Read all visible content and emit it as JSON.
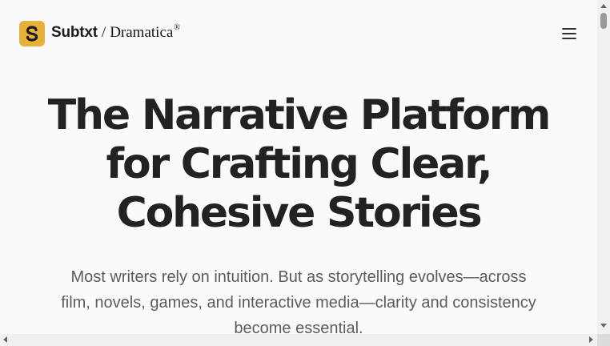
{
  "header": {
    "brand_name": "Subtxt",
    "brand_separator": "/",
    "brand_product": "Dramatica",
    "brand_registered": "®",
    "logo_icon": "subtxt-s-logo-icon",
    "menu_icon": "hamburger-menu-icon"
  },
  "hero": {
    "title_lines": [
      "The Narrative Platform",
      "for Crafting Clear,",
      "Cohesive Stories"
    ],
    "subtitle_lines": [
      "Most writers rely on intuition. But as storytelling evolves—across",
      "film, novels, games, and interactive media—clarity and consistency",
      "become essential."
    ]
  },
  "colors": {
    "logo_background": "#e8b23a",
    "logo_glyph": "#1a1a1a",
    "title_text": "#222222",
    "subtitle_text": "#5c5c5c",
    "page_background": "#fafafa"
  }
}
